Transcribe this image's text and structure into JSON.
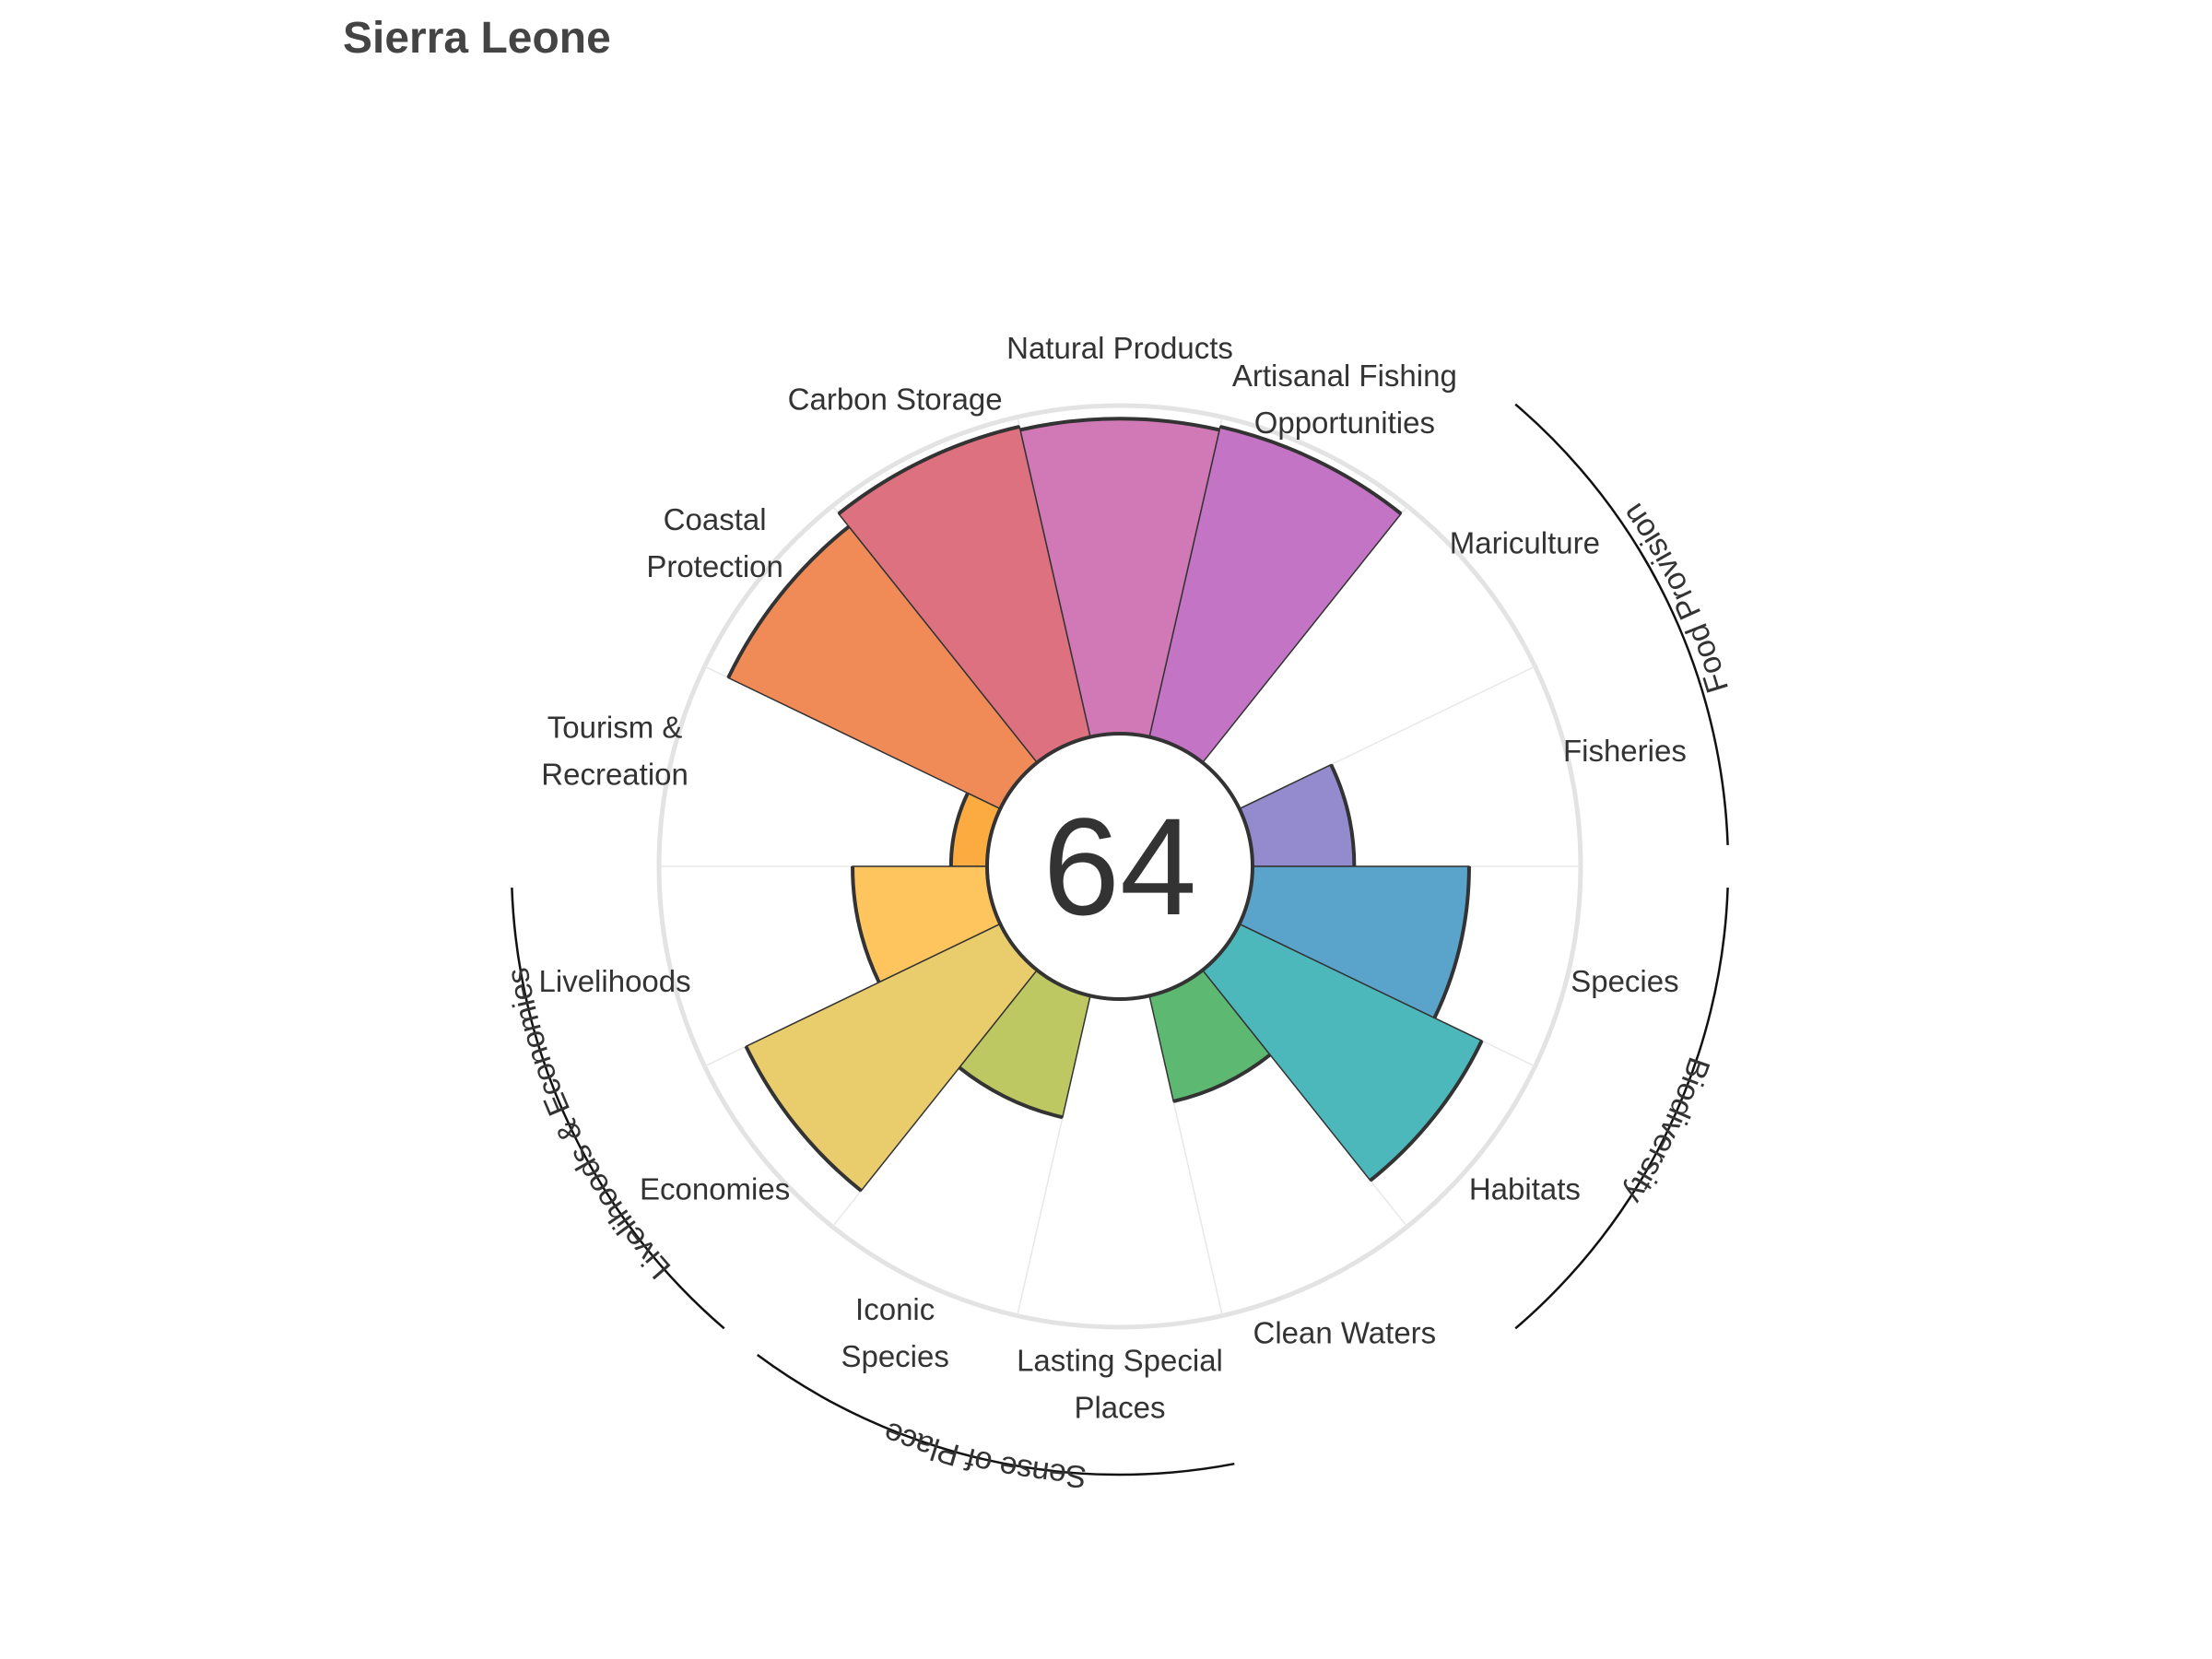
{
  "title": "Sierra Leone",
  "overall_score": "64",
  "chart_data": {
    "type": "polar-bar",
    "title": "Sierra Leone",
    "center_value": 64,
    "ylim": [
      0,
      100
    ],
    "categories": [
      {
        "label": [
          "Fisheries"
        ],
        "value": 31,
        "color": "#938bce"
      },
      {
        "label": [
          "Mariculture"
        ],
        "value": 0,
        "color": "#938bce"
      },
      {
        "label": [
          "Artisanal Fishing",
          "Opportunities"
        ],
        "value": 97,
        "color": "#c474c4"
      },
      {
        "label": [
          "Natural Products"
        ],
        "value": 96,
        "color": "#d179b6"
      },
      {
        "label": [
          "Carbon Storage"
        ],
        "value": 97,
        "color": "#dd717f"
      },
      {
        "label": [
          "Coastal",
          "Protection"
        ],
        "value": 92,
        "color": "#f08b57"
      },
      {
        "label": [
          "Tourism &",
          "Recreation"
        ],
        "value": 11,
        "color": "#fcab40"
      },
      {
        "label": [
          "Livelihoods"
        ],
        "value": 41,
        "color": "#fec55f"
      },
      {
        "label": [
          "Economies"
        ],
        "value": 86,
        "color": "#e9cd6c"
      },
      {
        "label": [
          "Iconic",
          "Species"
        ],
        "value": 38,
        "color": "#bec863"
      },
      {
        "label": [
          "Lasting Special",
          "Places"
        ],
        "value": 0,
        "color": "#9dc764"
      },
      {
        "label": [
          "Clean Waters"
        ],
        "value": 33,
        "color": "#5db872"
      },
      {
        "label": [
          "Habitats"
        ],
        "value": 82,
        "color": "#4cb8bb"
      },
      {
        "label": [
          "Species"
        ],
        "value": 66,
        "color": "#5aa3ca"
      }
    ],
    "groups": [
      {
        "label": "Food Provision",
        "from": 0,
        "to": 1
      },
      {
        "label": "Biodiversity",
        "from": 12,
        "to": 13
      },
      {
        "label": "Sense of Place",
        "from": 9,
        "to": 10
      },
      {
        "label": "Livelihoods & Economies",
        "from": 7,
        "to": 8
      }
    ]
  }
}
